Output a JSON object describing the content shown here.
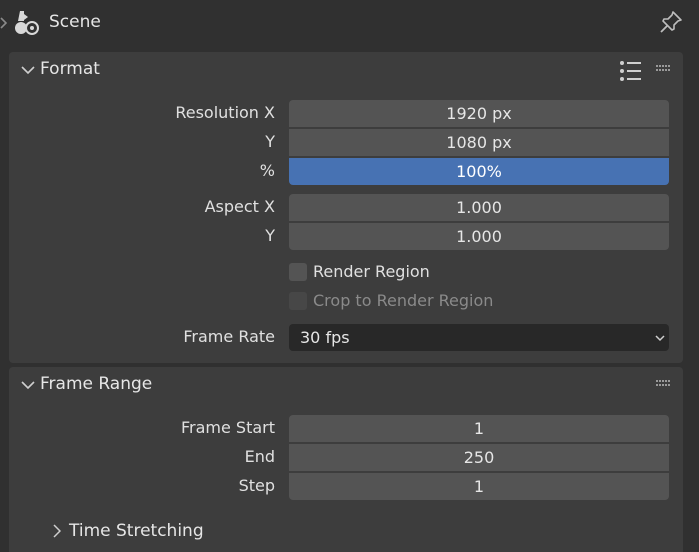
{
  "header": {
    "title": "Scene",
    "scene_icon": "scene-icon",
    "pin_icon": "pin-icon"
  },
  "format_panel": {
    "title": "Format",
    "resolution_x_label": "Resolution X",
    "resolution_x_value": "1920 px",
    "resolution_y_label": "Y",
    "resolution_y_value": "1080 px",
    "percent_label": "%",
    "percent_value": "100%",
    "aspect_x_label": "Aspect X",
    "aspect_x_value": "1.000",
    "aspect_y_label": "Y",
    "aspect_y_value": "1.000",
    "render_region_label": "Render Region",
    "render_region_checked": false,
    "crop_label": "Crop to Render Region",
    "crop_checked": false,
    "frame_rate_label": "Frame Rate",
    "frame_rate_value": "30 fps"
  },
  "frame_range_panel": {
    "title": "Frame Range",
    "frame_start_label": "Frame Start",
    "frame_start_value": "1",
    "end_label": "End",
    "end_value": "250",
    "step_label": "Step",
    "step_value": "1",
    "time_stretching_label": "Time Stretching"
  },
  "colors": {
    "background": "#303030",
    "panel": "#3d3d3d",
    "field": "#545454",
    "selected": "#4772b3",
    "dropdown": "#282828"
  }
}
